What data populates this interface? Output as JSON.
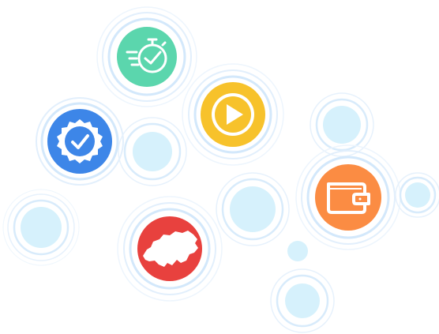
{
  "colors": {
    "ring": "#cfe6fb",
    "ring_soft": "#e6f2fd",
    "bubble": "#d6f1fc",
    "stopwatch_bg": "#5bd6ad",
    "play_bg": "#f7c22b",
    "badge_bg": "#3d86e8",
    "swiss_bg": "#e8413e",
    "wallet_bg": "#fb8c43",
    "icon_fg": "#ffffff"
  },
  "icons": [
    {
      "name": "stopwatch-check-icon"
    },
    {
      "name": "play-icon"
    },
    {
      "name": "verified-badge-icon"
    },
    {
      "name": "switzerland-map-icon"
    },
    {
      "name": "wallet-icon"
    }
  ]
}
